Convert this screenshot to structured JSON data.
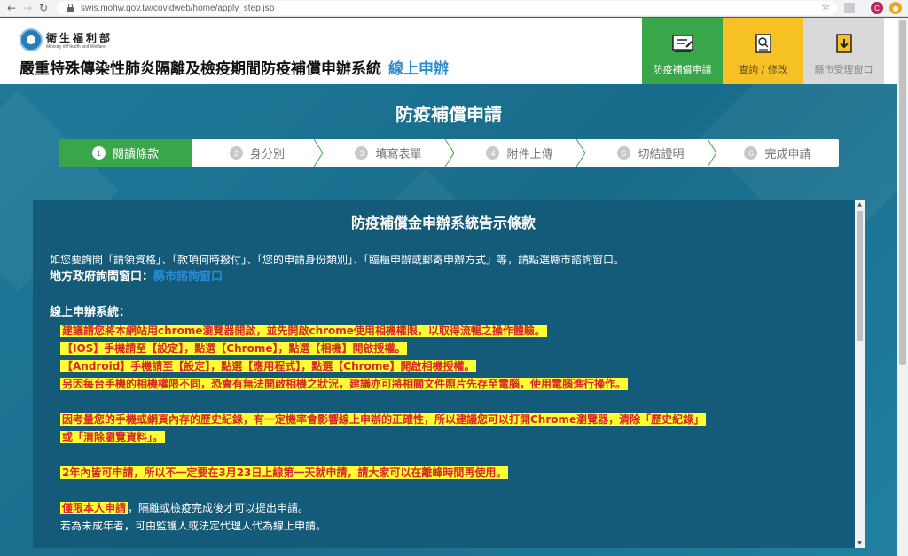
{
  "browser": {
    "url": "swis.mohw.gov.tw/covidweb/home/apply_step.jsp",
    "profile_initial": "C"
  },
  "header": {
    "logo_name": "衛生福利部",
    "logo_en": "Ministry of Health and Welfare",
    "title": "嚴重特殊傳染性肺炎隔離及檢疫期間防疫補償申辦系統",
    "title_accent": "線上申辦",
    "nav": [
      {
        "label": "防疫補償申請",
        "icon": "form-icon"
      },
      {
        "label": "查詢 / 修改",
        "icon": "search-document-icon"
      },
      {
        "label": "縣市受理窗口",
        "icon": "download-document-icon"
      }
    ]
  },
  "main": {
    "heading": "防疫補償申請",
    "steps": [
      {
        "num": "1",
        "label": "閱讀條款"
      },
      {
        "num": "2",
        "label": "身分別"
      },
      {
        "num": "3",
        "label": "填寫表單"
      },
      {
        "num": "4",
        "label": "附件上傳"
      },
      {
        "num": "5",
        "label": "切結證明"
      },
      {
        "num": "6",
        "label": "完成申請"
      }
    ]
  },
  "notice": {
    "title": "防疫補償金申辦系統告示條款",
    "intro": "如您要詢問「請領資格」、「款項何時撥付」、「您的申請身份類別」、「臨櫃申辦或郵寄申辦方式」等，請點選縣市諮詢窗口。",
    "local_label": "地方政府詢問窗口：",
    "local_link": "縣市諮詢窗口",
    "online_label": "線上申辦系統：",
    "hl_1": "建議請您將本網站用chrome瀏覽器開啟，並先開啟chrome使用相機權限，以取得流暢之操作體驗。",
    "hl_2": "【IOS】手機請至【設定】，點選【Chrome】，點選【相機】開啟授權。",
    "hl_3": "【Android】手機請至【設定】，點選【應用程式】，點選【Chrome】開啟相機授權。",
    "hl_4": "另因每台手機的相機權限不同，恐會有無法開啟相機之狀況，建議亦可將相關文件照片先存至電腦，使用電腦進行操作。",
    "hl_5": "因考量您的手機或網頁內存的歷史紀錄，有一定機率會影響線上申辦的正確性，所以建議您可以打開Chrome瀏覽器，清除「歷史紀錄」",
    "hl_6": "或「清除瀏覽資料」。",
    "hl_7": "2年內皆可申請，所以不一定要在3月23日上線第一天就申請，請大家可以在離峰時間再使用。",
    "hl_8": "僅限本人申請",
    "line_8_rest": "，隔離或檢疫完成後才可以提出申請。",
    "line_9": "若為未成年者，可由監護人或法定代理人代為線上申請。"
  }
}
